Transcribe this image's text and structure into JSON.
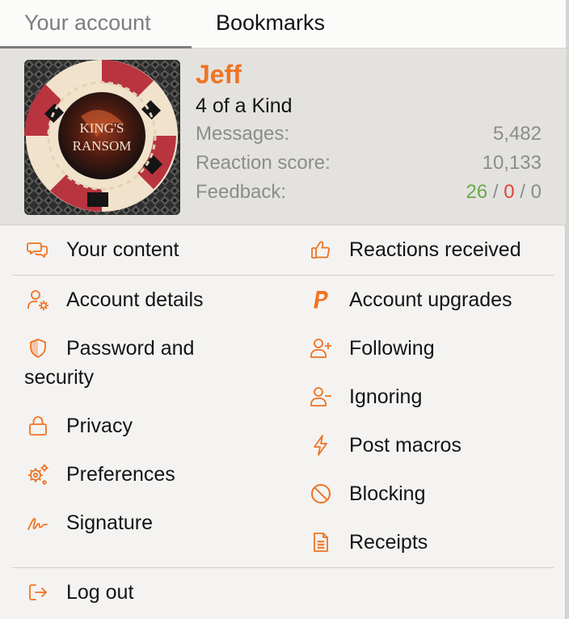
{
  "tabs": [
    {
      "label": "Your account"
    },
    {
      "label": "Bookmarks"
    }
  ],
  "user": {
    "name": "Jeff",
    "title": "4 of a Kind",
    "avatar_text": [
      "KING'S",
      "RANSOM"
    ],
    "stats": {
      "messages_label": "Messages:",
      "messages_value": "5,482",
      "reaction_label": "Reaction score:",
      "reaction_value": "10,133",
      "feedback_label": "Feedback:",
      "feedback_positive": "26",
      "feedback_negative": "0",
      "feedback_neutral": "0",
      "feedback_sep": "/"
    }
  },
  "menu": {
    "your_content": "Your content",
    "reactions_received": "Reactions received",
    "account_details": "Account details",
    "account_upgrades": "Account upgrades",
    "password_line1": "Password and",
    "password_line2": "security",
    "following": "Following",
    "ignoring": "Ignoring",
    "privacy": "Privacy",
    "post_macros": "Post macros",
    "preferences": "Preferences",
    "blocking": "Blocking",
    "signature": "Signature",
    "receipts": "Receipts",
    "log_out": "Log out"
  },
  "colors": {
    "accent": "#f07322",
    "positive": "#69a949",
    "negative": "#e0433b"
  }
}
